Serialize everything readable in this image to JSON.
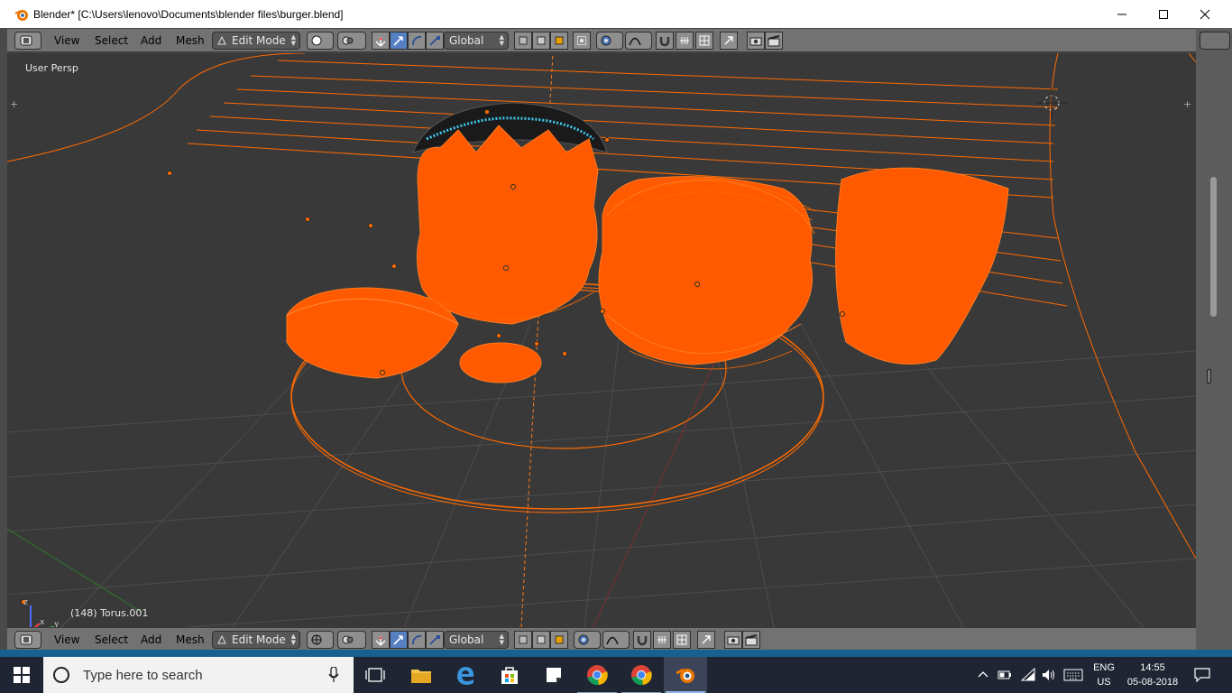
{
  "window": {
    "title": "Blender* [C:\\Users\\lenovo\\Documents\\blender files\\burger.blend]"
  },
  "header_top": {
    "menus": [
      "View",
      "Select",
      "Add",
      "Mesh"
    ],
    "mode": "Edit Mode",
    "orientation": "Global"
  },
  "header_bottom": {
    "menus": [
      "View",
      "Select",
      "Add",
      "Mesh"
    ],
    "mode": "Edit Mode",
    "orientation": "Global"
  },
  "viewport": {
    "view_label": "User Persp",
    "object_label": "(148) Torus.001",
    "axis_x": "x",
    "axis_y": "y",
    "axis_z": "z",
    "colors": {
      "selection": "#ff5a00",
      "background": "#393939",
      "grid": "#505050"
    }
  },
  "taskbar": {
    "search_placeholder": "Type here to search",
    "lang_top": "ENG",
    "lang_bottom": "US",
    "time": "14:55",
    "date": "05-08-2018"
  }
}
